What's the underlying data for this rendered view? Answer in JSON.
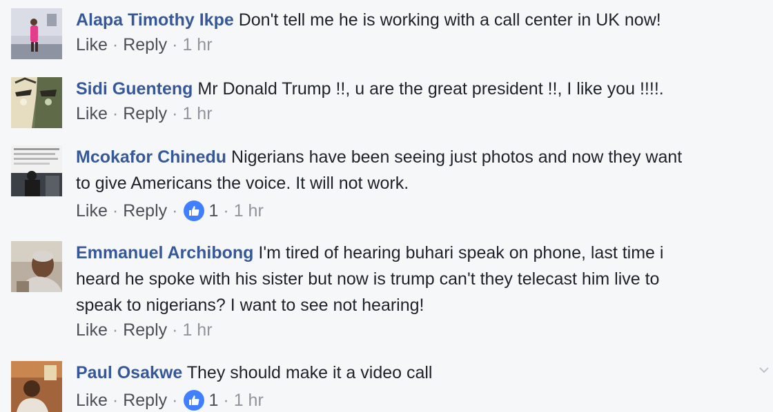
{
  "comments": [
    {
      "author": "Alapa Timothy Ikpe",
      "text": "Don't tell me he is working with a call center in UK now!",
      "like_label": "Like",
      "reply_label": "Reply",
      "time": "1 hr",
      "reaction_count": null
    },
    {
      "author": "Sidi Guenteng",
      "text": "Mr Donald Trump !!, u are the great president !!, I like you !!!!.",
      "like_label": "Like",
      "reply_label": "Reply",
      "time": "1 hr",
      "reaction_count": null
    },
    {
      "author": "Mcokafor Chinedu",
      "text_line1": "Nigerians have been seeing just photos and now they want",
      "text_line2": "to give Americans the voice. It will not work.",
      "like_label": "Like",
      "reply_label": "Reply",
      "time": "1 hr",
      "reaction_count": "1"
    },
    {
      "author": "Emmanuel Archibong",
      "text_line1": "I'm tired of hearing buhari speak on phone, last time i",
      "text_line2": "heard he spoke with his sister but now is trump can't they telecast him live to",
      "text_line3": "speak to nigerians? I want to see not hearing!",
      "like_label": "Like",
      "reply_label": "Reply",
      "time": "1 hr",
      "reaction_count": null
    },
    {
      "author": "Paul Osakwe",
      "text": "They should make it a video call",
      "like_label": "Like",
      "reply_label": "Reply",
      "time": "1 hr",
      "reaction_count": "1"
    }
  ],
  "separator": "·",
  "colors": {
    "author": "#365899",
    "meta": "#90949c",
    "like_badge": "#4080ff",
    "background": "#f6f7f9"
  },
  "icons": {
    "reaction": "thumbs-up-icon",
    "options": "chevron-down-icon"
  }
}
